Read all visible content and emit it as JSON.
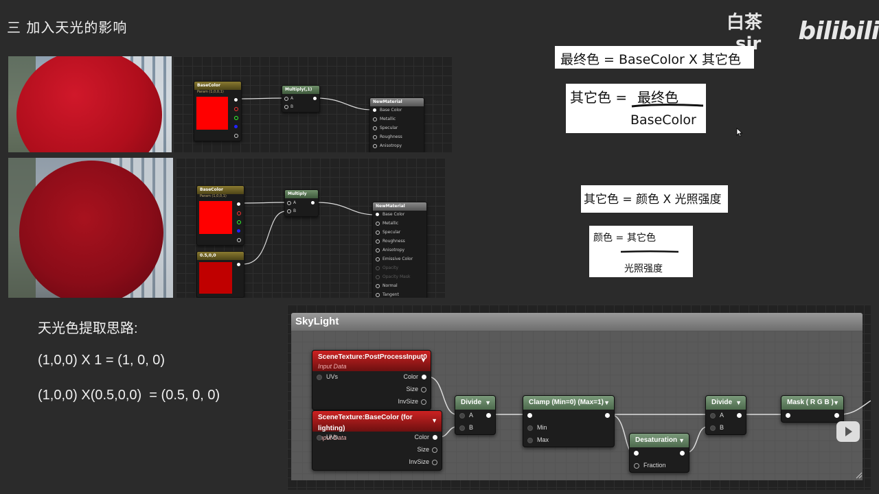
{
  "slide": {
    "title": "三 加入天光的影响",
    "author": "白茶_sir",
    "brand": "bilibili"
  },
  "formulas": {
    "f1": "最终色 = BaseColor X 其它色",
    "f2_lhs": "其它色 =",
    "f2_num": "最终色",
    "f2_den": "BaseColor",
    "f3": "其它色 = 颜色 X 光照强度",
    "f4_lhs": "颜色 =",
    "f4_num": "其它色",
    "f4_den": "光照强度"
  },
  "notes": {
    "heading": "天光色提取思路:",
    "line1": "(1,0,0) X 1 = (1, 0, 0)",
    "line2": "(1,0,0) X(0.5,0,0)  = (0.5, 0, 0)"
  },
  "graph_top": {
    "param_title": "BaseColor",
    "param_sub": "Param (1,0,0,1)",
    "mult_title": "Multiply(,1)",
    "pin_a": "A",
    "pin_b": "B",
    "mat_title": "NewMaterial",
    "mat_pins": [
      "Base Color",
      "Metallic",
      "Specular",
      "Roughness",
      "Anisotropy"
    ]
  },
  "graph_mid": {
    "param_title": "BaseColor",
    "param_sub": "Param (1,0,0,1)",
    "const_title": "0.5,0,0",
    "mult_title": "Multiply",
    "pin_a": "A",
    "pin_b": "B",
    "mat_title": "NewMaterial",
    "mat_pins": [
      "Base Color",
      "Metallic",
      "Specular",
      "Roughness",
      "Anisotropy",
      "Emissive Color",
      "Opacity",
      "Opacity Mask",
      "Normal",
      "Tangent"
    ]
  },
  "skylight": {
    "title": "SkyLight",
    "tex1_title": "SceneTexture:PostProcessInput0",
    "tex1_sub": "Input Data",
    "tex2_title": "SceneTexture:BaseColor (for lighting)",
    "tex2_sub": "Input Data",
    "uvs": "UVs",
    "color": "Color",
    "size": "Size",
    "invsize": "InvSize",
    "divide": "Divide",
    "clamp": "Clamp (Min=0) (Max=1)",
    "min": "Min",
    "max": "Max",
    "desat": "Desaturation",
    "fraction": "Fraction",
    "mask": "Mask ( R G B )",
    "a": "A",
    "b": "B"
  },
  "colors": {
    "sphere_top": "#c0101e",
    "sphere_mid": "#9a0c1a",
    "swatch_red": "#ff0000",
    "swatch_dark": "#c00000"
  }
}
